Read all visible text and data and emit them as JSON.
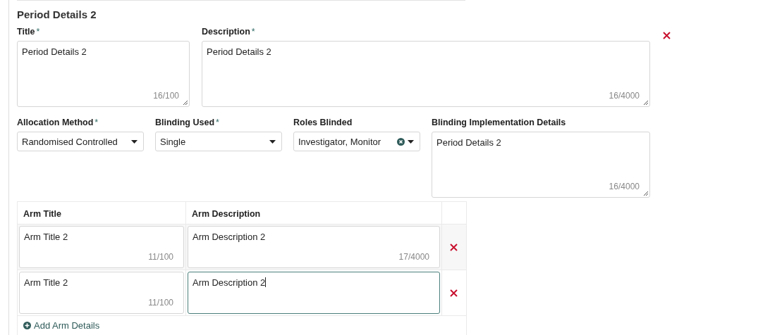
{
  "section": {
    "title": "Period Details 2"
  },
  "required_marker": "*",
  "fields_top": [
    {
      "label": "Title",
      "required": true,
      "value": "Period Details 2",
      "counter": "16/100",
      "kind": "narrow"
    },
    {
      "label": "Description",
      "required": true,
      "value": "Period Details 2",
      "counter": "16/4000",
      "kind": "wide"
    }
  ],
  "selects": [
    {
      "label": "Allocation Method",
      "required": true,
      "value": "Randomised Controlled",
      "clearable": false
    },
    {
      "label": "Blinding Used",
      "required": true,
      "value": "Single",
      "clearable": false
    },
    {
      "label": "Roles Blinded",
      "required": false,
      "value": "Investigator, Monitor",
      "clearable": true
    }
  ],
  "implementation": {
    "label": "Blinding Implementation Details",
    "required": false,
    "value": "Period Details 2",
    "counter": "16/4000"
  },
  "arms": {
    "columns": [
      "Arm Title",
      "Arm Description"
    ],
    "rows": [
      {
        "title": "Arm Title 2",
        "title_counter": "11/100",
        "description": "Arm Description 2",
        "description_counter": "17/4000",
        "focused": false
      },
      {
        "title": "Arm Title 2",
        "title_counter": "11/100",
        "description": "Arm Description 2",
        "focused": true
      }
    ],
    "add_link": "Add Arm Details"
  }
}
